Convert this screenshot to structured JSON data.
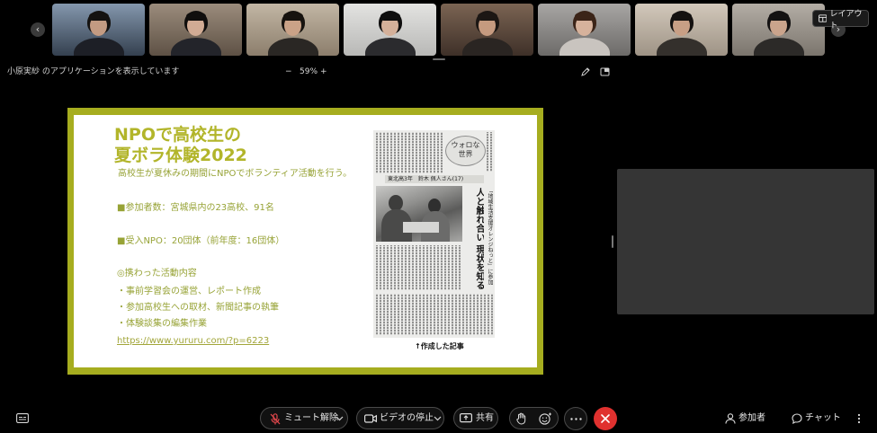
{
  "top_bar": {
    "prev_arrow": "‹",
    "next_arrow": "›",
    "layout_label": "レイアウト",
    "thumbnails": [
      {
        "bg": "#8497ad",
        "bg2": "#34404f",
        "hair": "#141210",
        "skin": "#c39b82",
        "shirt": "#1d1f26"
      },
      {
        "bg": "#9b8c7c",
        "bg2": "#5e5145",
        "hair": "#100e0d",
        "skin": "#d1ab94",
        "shirt": "#23242a"
      },
      {
        "bg": "#c2b6a4",
        "bg2": "#8c7e6c",
        "hair": "#17130f",
        "skin": "#caa287",
        "shirt": "#2a2724"
      },
      {
        "bg": "#e3e3e1",
        "bg2": "#b8b8b6",
        "hair": "#0f0e0e",
        "skin": "#d4b09a",
        "shirt": "#2b2b2e"
      },
      {
        "bg": "#7b6453",
        "bg2": "#3e3028",
        "hair": "#1c1714",
        "skin": "#c59a7f",
        "shirt": "#2a2522"
      },
      {
        "bg": "#a8a6a4",
        "bg2": "#6c6a68",
        "hair": "#3b2418",
        "skin": "#d6b29c",
        "shirt": "#c9c4bf"
      },
      {
        "bg": "#d2c8bb",
        "bg2": "#9e9385",
        "hair": "#141110",
        "skin": "#c89f85",
        "shirt": "#34302c"
      },
      {
        "bg": "#b3ada5",
        "bg2": "#7b756d",
        "hair": "#141212",
        "skin": "#caa48c",
        "shirt": "#2c2a28"
      }
    ]
  },
  "share_bar": {
    "presenter_text": "小原実紗 のアプリケーションを表示しています",
    "zoom_out": "−",
    "zoom_level": "59%",
    "zoom_in": "+"
  },
  "slide": {
    "title_line1": "NPOで高校生の",
    "title_line2": "夏ボラ体験2022",
    "intro": "高校生が夏休みの期間にNPOでボランティア活動を行う。",
    "participants": "■参加者数：宮城県内の23高校、91名",
    "npo": "■受入NPO：20団体（前年度：16団体）",
    "activities_heading": "◎携わった活動内容",
    "activities": [
      "・事前学習会の運営、レポート作成",
      "・参加高校生への取材、新聞記事の執筆",
      "・体験談集の編集作業"
    ],
    "link": "https://www.yururu.com/?p=6223",
    "clipping": {
      "column_title_1": "ウォロな",
      "column_title_2": "世界",
      "byline": "東北高3年　鈴木 佩人さん(17)",
      "headline": "人と触れ合い 現状を知る",
      "subhead": "「地域生活支援オレンジねっと」に参加"
    },
    "caption": "↑作成した記事"
  },
  "controls": {
    "mute_label": "ミュート解除",
    "video_label": "ビデオの停止",
    "share_label": "共有",
    "participants_label": "参加者",
    "chat_label": "チャット"
  },
  "colors": {
    "slide_border": "#a6ad1f",
    "slide_title": "#b2b52a",
    "slide_body": "#97a336",
    "mute_icon": "#e5484d",
    "end_call": "#e0312f"
  }
}
